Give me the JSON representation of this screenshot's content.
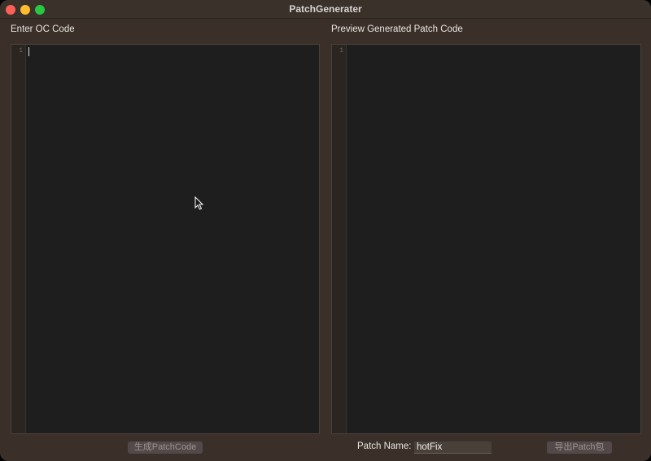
{
  "window": {
    "title": "PatchGenerater"
  },
  "left_panel": {
    "label": "Enter OC Code",
    "line_number": "1"
  },
  "right_panel": {
    "label": "Preview Generated Patch Code",
    "line_number": "1"
  },
  "footer": {
    "generate_button": "生成PatchCode",
    "patch_name_label": "Patch Name:",
    "patch_name_value": "hotFix",
    "export_button": "导出Patch包"
  },
  "colors": {
    "window_bg": "#3a3029",
    "editor_bg": "#1e1e1e",
    "close": "#fe5f57",
    "minimize": "#febc2e",
    "maximize": "#28c840"
  }
}
